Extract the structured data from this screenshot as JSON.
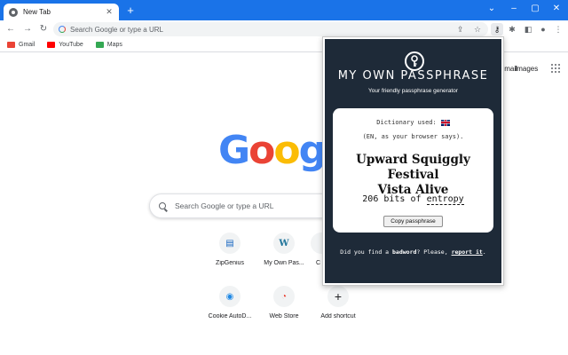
{
  "browser": {
    "tab_title": "New Tab",
    "tab_close": "✕",
    "new_tab": "+",
    "omnibox_placeholder": "Search Google or type a URL",
    "window_controls": [
      "⌄",
      "–",
      "▢",
      "✕"
    ]
  },
  "bookmarks": [
    {
      "label": "Gmail",
      "color": "#ea4335"
    },
    {
      "label": "YouTube",
      "color": "#ff0000"
    },
    {
      "label": "Maps",
      "color": "#34a853"
    }
  ],
  "ntp": {
    "gmail_link": "Gmail",
    "images_link": "Images",
    "logo": [
      "G",
      "o",
      "o",
      "g"
    ],
    "logo_colors": [
      "#4285f4",
      "#ea4335",
      "#fbbc05",
      "#4285f4"
    ],
    "search_placeholder": "Search Google or type a URL",
    "shortcuts": [
      {
        "label": "ZipGenius",
        "glyph": "🗂"
      },
      {
        "label": "My Own Pas...",
        "glyph": "W"
      },
      {
        "label": "C",
        "glyph": ""
      },
      {
        "label": "Cookie AutoD...",
        "glyph": "🍪"
      },
      {
        "label": "Web Store",
        "glyph": "◔"
      },
      {
        "label": "Add shortcut",
        "glyph": "+"
      }
    ]
  },
  "popup": {
    "title": "MY OWN PASSPHRASE",
    "subtitle": "Your friendly passphrase generator",
    "dictionary_label": "Dictionary used:",
    "language_note": "(EN, as your browser says).",
    "passphrase_line1": "Upward Squiggly Festival",
    "passphrase_line2": "Vista Alive",
    "entropy_bits": "206",
    "entropy_middle": "bits of",
    "entropy_word": "entropy",
    "copy_button": "Copy passphrase",
    "footer_prefix": "Did you find a",
    "footer_badword": "badword",
    "footer_middle": "? Please,",
    "footer_link": "report it",
    "footer_end": ".",
    "bg_color": "#1e2a38"
  }
}
